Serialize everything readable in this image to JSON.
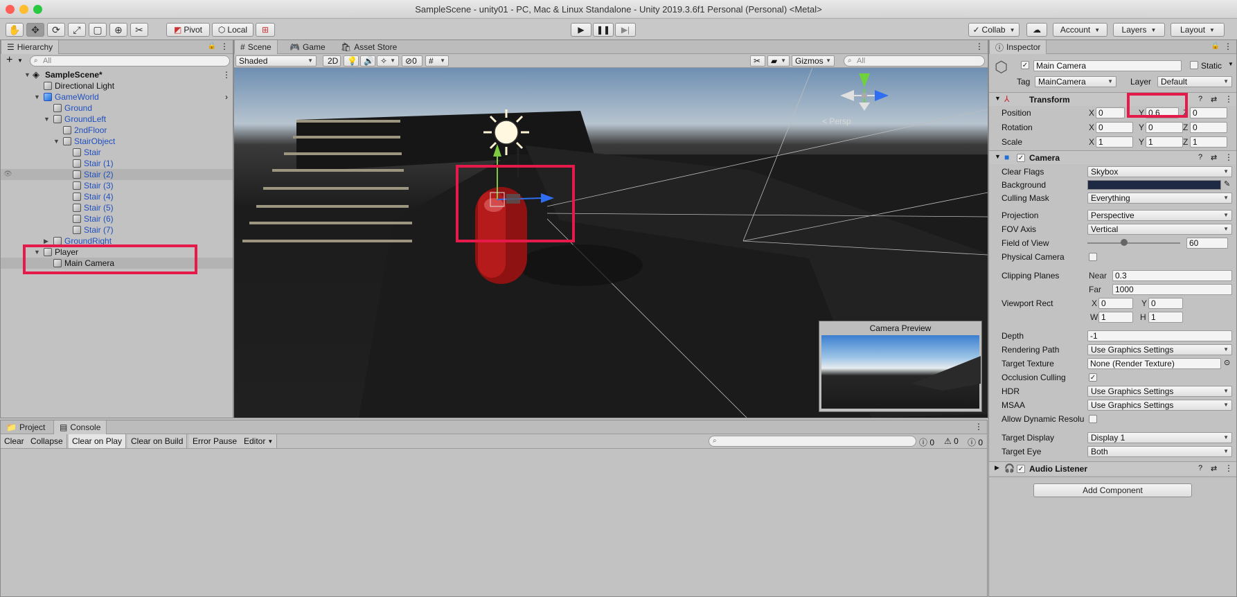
{
  "window": {
    "title": "SampleScene - unity01 - PC, Mac & Linux Standalone - Unity 2019.3.6f1 Personal (Personal) <Metal>"
  },
  "toolbar": {
    "pivot": "Pivot",
    "local": "Local",
    "collab": "Collab",
    "account": "Account",
    "layers": "Layers",
    "layout": "Layout"
  },
  "hierarchy": {
    "tab": "Hierarchy",
    "add": "+",
    "search_placeholder": "All",
    "rows": [
      {
        "label": "SampleScene*"
      },
      {
        "label": "Directional Light"
      },
      {
        "label": "GameWorld"
      },
      {
        "label": "Ground"
      },
      {
        "label": "GroundLeft"
      },
      {
        "label": "2ndFloor"
      },
      {
        "label": "StairObject"
      },
      {
        "label": "Stair"
      },
      {
        "label": "Stair (1)"
      },
      {
        "label": "Stair (2)"
      },
      {
        "label": "Stair (3)"
      },
      {
        "label": "Stair (4)"
      },
      {
        "label": "Stair (5)"
      },
      {
        "label": "Stair (6)"
      },
      {
        "label": "Stair (7)"
      },
      {
        "label": "GroundRight"
      },
      {
        "label": "Player"
      },
      {
        "label": "Main Camera"
      }
    ]
  },
  "scene": {
    "tabs": [
      "Scene",
      "Game",
      "Asset Store"
    ],
    "shading": "Shaded",
    "mode_2d": "2D",
    "hidden_count": "0",
    "gizmos": "Gizmos",
    "search_placeholder": "All",
    "persp_label": "< Persp",
    "camera_preview_title": "Camera Preview"
  },
  "console": {
    "tabs": [
      "Project",
      "Console"
    ],
    "buttons": [
      "Clear",
      "Collapse",
      "Clear on Play",
      "Clear on Build",
      "Error Pause",
      "Editor"
    ],
    "counts": [
      "0",
      "0",
      "0"
    ]
  },
  "inspector": {
    "tab": "Inspector",
    "object_name": "Main Camera",
    "static_label": "Static",
    "tag_label": "Tag",
    "tag_value": "MainCamera",
    "layer_label": "Layer",
    "layer_value": "Default",
    "transform": {
      "title": "Transform",
      "position_label": "Position",
      "rotation_label": "Rotation",
      "scale_label": "Scale",
      "position": {
        "x": "0",
        "y": "0.6",
        "z": "0"
      },
      "rotation": {
        "x": "0",
        "y": "0",
        "z": "0"
      },
      "scale": {
        "x": "1",
        "y": "1",
        "z": "1"
      }
    },
    "camera": {
      "title": "Camera",
      "clear_flags_label": "Clear Flags",
      "clear_flags": "Skybox",
      "background_label": "Background",
      "background_color": "#1e2a44",
      "culling_mask_label": "Culling Mask",
      "culling_mask": "Everything",
      "projection_label": "Projection",
      "projection": "Perspective",
      "fov_axis_label": "FOV Axis",
      "fov_axis": "Vertical",
      "fov_label": "Field of View",
      "fov": "60",
      "physical_label": "Physical Camera",
      "clipping_label": "Clipping Planes",
      "near_label": "Near",
      "near": "0.3",
      "far_label": "Far",
      "far": "1000",
      "viewport_label": "Viewport Rect",
      "vp_x": "0",
      "vp_y": "0",
      "vp_w": "1",
      "vp_h": "1",
      "depth_label": "Depth",
      "depth": "-1",
      "rendering_path_label": "Rendering Path",
      "rendering_path": "Use Graphics Settings",
      "target_texture_label": "Target Texture",
      "target_texture": "None (Render Texture)",
      "occlusion_label": "Occlusion Culling",
      "hdr_label": "HDR",
      "hdr": "Use Graphics Settings",
      "msaa_label": "MSAA",
      "msaa": "Use Graphics Settings",
      "dynamic_res_label": "Allow Dynamic Resolu",
      "target_display_label": "Target Display",
      "target_display": "Display 1",
      "target_eye_label": "Target Eye",
      "target_eye": "Both"
    },
    "audio_listener": "Audio Listener",
    "add_component": "Add Component"
  },
  "colors": {
    "highlight": "#e6194b",
    "accent_blue": "#1f4fbf"
  }
}
